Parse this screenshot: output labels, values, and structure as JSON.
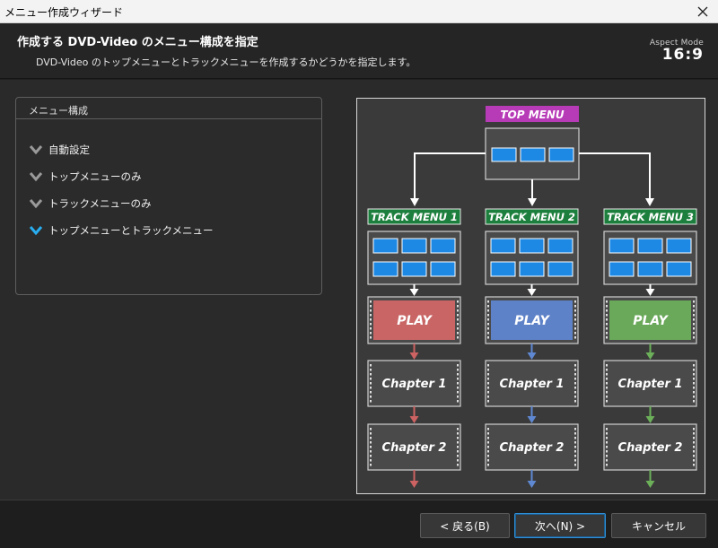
{
  "window": {
    "title": "メニュー作成ウィザード",
    "close_icon": "close-icon"
  },
  "header": {
    "title": "作成する DVD-Video のメニュー構成を指定",
    "subtitle": "DVD-Video のトップメニューとトラックメニューを作成するかどうかを指定します。",
    "aspect_label": "Aspect Mode",
    "aspect_value": "16:9"
  },
  "menu_config": {
    "heading": "メニュー構成",
    "options": [
      {
        "label": "自動設定",
        "selected": false
      },
      {
        "label": "トップメニューのみ",
        "selected": false
      },
      {
        "label": "トラックメニューのみ",
        "selected": false
      },
      {
        "label": "トップメニューとトラックメニュー",
        "selected": true
      }
    ]
  },
  "diagram": {
    "top_menu": "TOP MENU",
    "tracks": [
      {
        "menu": "TRACK MENU 1",
        "play": "PLAY",
        "chapters": [
          "Chapter 1",
          "Chapter 2"
        ],
        "color": "#c96565",
        "arrow_color": "#cc6262"
      },
      {
        "menu": "TRACK MENU 2",
        "play": "PLAY",
        "chapters": [
          "Chapter 1",
          "Chapter 2"
        ],
        "color": "#5e82c8",
        "arrow_color": "#5f88d2"
      },
      {
        "menu": "TRACK MENU 3",
        "play": "PLAY",
        "chapters": [
          "Chapter 1",
          "Chapter 2"
        ],
        "color": "#6aa85a",
        "arrow_color": "#6cb05a"
      }
    ],
    "colors": {
      "top_menu_bg": "#b73ab7",
      "track_menu_bg": "#1d7f3d",
      "thumb": "#1e88e5"
    }
  },
  "footer": {
    "back": "< 戻る(B)",
    "next": "次へ(N) >",
    "cancel": "キャンセル"
  }
}
